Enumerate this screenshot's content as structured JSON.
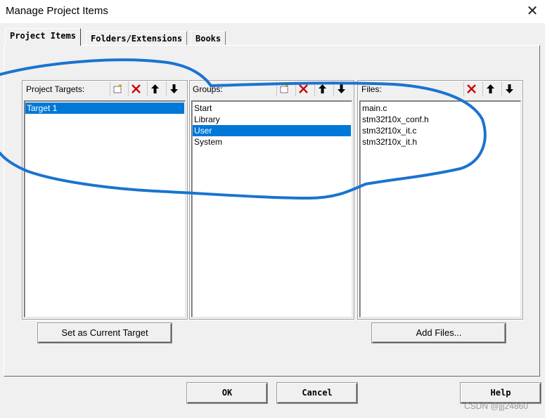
{
  "window": {
    "title": "Manage Project Items",
    "close_glyph": "✕"
  },
  "tabs": [
    {
      "label": "Project Items",
      "active": true
    },
    {
      "label": "Folders/Extensions",
      "active": false
    },
    {
      "label": "Books",
      "active": false
    }
  ],
  "targets": {
    "label": "Project Targets:",
    "items": [
      "Target 1"
    ],
    "selected_index": 0,
    "button_label": "Set as Current Target"
  },
  "groups": {
    "label": "Groups:",
    "items": [
      "Start",
      "Library",
      "User",
      "System"
    ],
    "selected_index": 2
  },
  "files": {
    "label": "Files:",
    "items": [
      "main.c",
      "stm32f10x_conf.h",
      "stm32f10x_it.c",
      "stm32f10x_it.h"
    ],
    "button_label": "Add Files..."
  },
  "footer": {
    "ok": "OK",
    "cancel": "Cancel",
    "help": "Help"
  },
  "watermark": "CSDN @jjj24860",
  "icons": {
    "new": "new-item-icon",
    "delete": "delete-icon",
    "up": "move-up-icon",
    "down": "move-down-icon"
  },
  "colors": {
    "selection": "#0078d7",
    "delete_red": "#cc0000",
    "scribble_blue": "#1a73d0"
  }
}
